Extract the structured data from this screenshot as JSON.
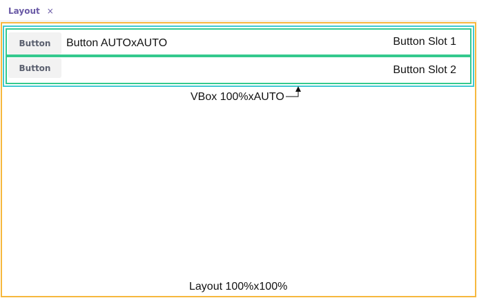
{
  "tab": {
    "label": "Layout",
    "close_glyph": "×"
  },
  "diagram": {
    "buttons": [
      {
        "label": "Button"
      },
      {
        "label": "Button"
      }
    ],
    "button_size_label": "Button AUTOxAUTO",
    "slot_labels": [
      "Button Slot 1",
      "Button Slot 2"
    ],
    "vbox_label": "VBox 100%xAUTO",
    "layout_label": "Layout 100%x100%"
  },
  "colors": {
    "tab_text": "#6a5aa6",
    "layout_border": "#f6b73c",
    "vbox_border": "#3fc9d2",
    "slot_border": "#34c98e",
    "button_bg": "#f2f2f2"
  }
}
